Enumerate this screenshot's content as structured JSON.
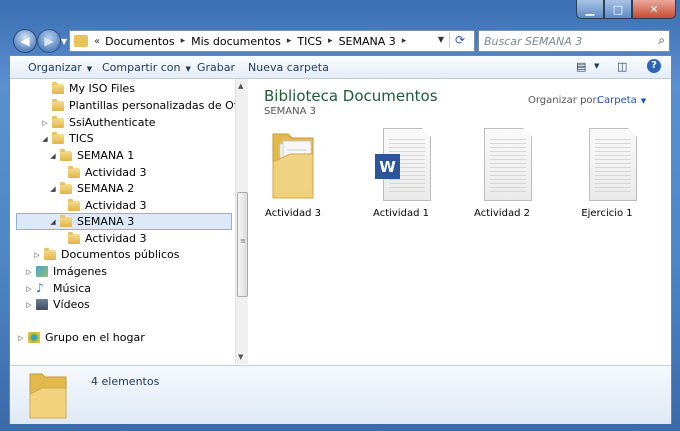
{
  "address": {
    "crumbs": [
      "Documentos",
      "Mis documentos",
      "TICS",
      "SEMANA 3"
    ],
    "search_placeholder": "Buscar SEMANA 3"
  },
  "toolbar": {
    "organize": "Organizar",
    "share": "Compartir con",
    "burn": "Grabar",
    "new_folder": "Nueva carpeta"
  },
  "tree": [
    {
      "label": "My ISO Files"
    },
    {
      "label": "Plantillas personalizadas de Office"
    },
    {
      "label": "SsiAuthenticate"
    },
    {
      "label": "TICS"
    },
    {
      "label": "SEMANA 1"
    },
    {
      "label": "Actividad 3"
    },
    {
      "label": "SEMANA 2"
    },
    {
      "label": "Actividad 3"
    },
    {
      "label": "SEMANA 3",
      "selected": true
    },
    {
      "label": "Actividad 3"
    },
    {
      "label": "Documentos públicos"
    },
    {
      "label": "Imágenes"
    },
    {
      "label": "Música"
    },
    {
      "label": "Vídeos"
    },
    {
      "label": "Grupo en el hogar"
    }
  ],
  "library": {
    "title": "Biblioteca Documentos",
    "subtitle": "SEMANA 3",
    "arrange_label": "Organizar por:",
    "arrange_value": "Carpeta"
  },
  "files": [
    {
      "name": "Actividad 3",
      "kind": "folder"
    },
    {
      "name": "Actividad 1",
      "kind": "word-document"
    },
    {
      "name": "Actividad 2",
      "kind": "document"
    },
    {
      "name": "Ejercicio 1",
      "kind": "document"
    }
  ],
  "details": {
    "count": "4 elementos"
  },
  "colors": {
    "library_title": "#1e5a36",
    "word_badge": "#2b579a",
    "link_blue": "#1c53b4"
  }
}
